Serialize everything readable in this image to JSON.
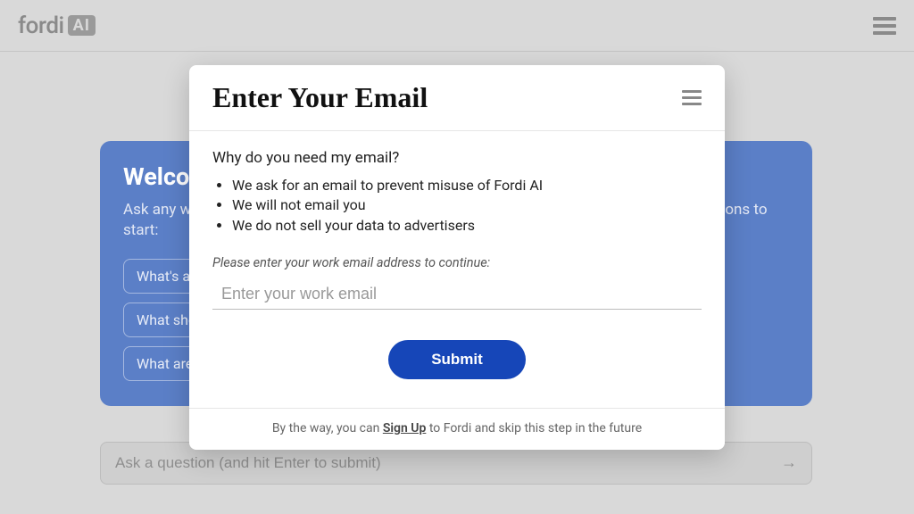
{
  "header": {
    "logo_text": "fordi",
    "logo_badge": "AI"
  },
  "welcome": {
    "title": "Welcome to Fordi AI",
    "subtitle": "Ask any work-related question and get an instant answer. Try one of these example questions to start:",
    "suggestions": [
      "What's a good icebreaker to start a meeting?",
      "What should I know before writing a job description?",
      "What are some questions to answer when planning a team offsite?"
    ]
  },
  "input": {
    "placeholder": "Ask a question (and hit Enter to submit)"
  },
  "modal": {
    "title": "Enter Your Email",
    "why_heading": "Why do you need my email?",
    "why_bullets": [
      "We ask for an email to prevent misuse of Fordi AI",
      "We will not email you",
      "We do not sell your data to advertisers"
    ],
    "instruction": "Please enter your work email address to continue:",
    "email_placeholder": "Enter your work email",
    "submit_label": "Submit",
    "footer_prefix": "By the way, you can ",
    "footer_signup": "Sign Up",
    "footer_suffix": " to Fordi and skip this step in the future"
  }
}
